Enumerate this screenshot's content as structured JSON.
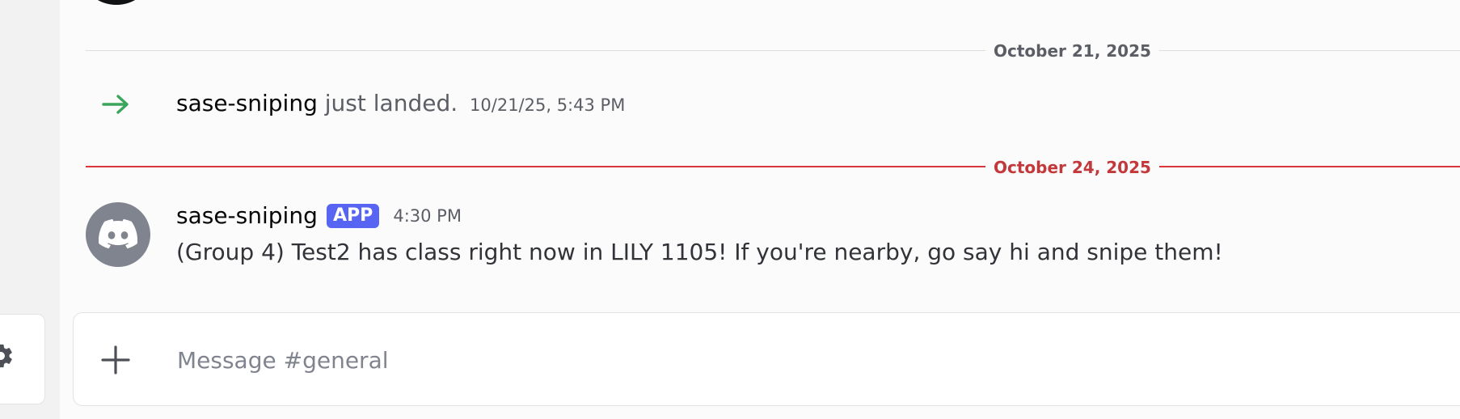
{
  "colors": {
    "accent": "#5865f2",
    "new_divider": "#da373c",
    "join_arrow": "#3ba55c",
    "avatar_bg": "#80848e"
  },
  "icons": {
    "settings": "gear-icon",
    "join": "arrow-right-icon",
    "bot_avatar": "discord-logo-icon",
    "attach": "plus-icon"
  },
  "dividers": [
    {
      "date": "October 21, 2025"
    },
    {
      "date": "October 24, 2025"
    }
  ],
  "join_event": {
    "username": "sase-sniping",
    "text": "just landed.",
    "timestamp": "10/21/25, 5:43 PM"
  },
  "message": {
    "username": "sase-sniping",
    "badge": "APP",
    "timestamp": "4:30 PM",
    "content": "(Group 4) Test2 has class right now in LILY 1105! If you're nearby, go say hi and snipe them!"
  },
  "composer": {
    "placeholder": "Message #general",
    "value": ""
  }
}
